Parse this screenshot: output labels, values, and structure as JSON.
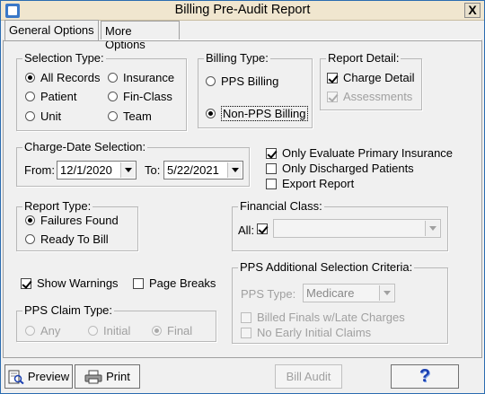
{
  "window": {
    "title": "Billing Pre-Audit Report",
    "close_glyph": "X"
  },
  "tabs": [
    "General Options",
    "More Options"
  ],
  "selection_type": {
    "label": "Selection Type:",
    "options": [
      "All Records",
      "Insurance",
      "Patient",
      "Fin-Class",
      "Unit",
      "Team"
    ],
    "selected": "All Records"
  },
  "billing_type": {
    "label": "Billing Type:",
    "options": [
      "PPS Billing",
      "Non-PPS Billing"
    ],
    "selected": "Non-PPS Billing"
  },
  "report_detail": {
    "label": "Report Detail:",
    "charge_detail": "Charge Detail",
    "assessments": "Assessments"
  },
  "charge_date": {
    "label": "Charge-Date Selection:",
    "from_label": "From:",
    "from_value": "12/1/2020",
    "to_label": "To:",
    "to_value": "5/22/2021"
  },
  "options": {
    "only_primary": "Only Evaluate Primary Insurance",
    "only_discharged": "Only Discharged Patients",
    "export": "Export Report"
  },
  "report_type": {
    "label": "Report Type:",
    "options": [
      "Failures Found",
      "Ready To Bill"
    ],
    "selected": "Failures Found"
  },
  "financial_class": {
    "label": "Financial Class:",
    "all_label": "All:",
    "value": ""
  },
  "show_warnings": "Show Warnings",
  "page_breaks": "Page Breaks",
  "pps_claim_type": {
    "label": "PPS Claim Type:",
    "options": [
      "Any",
      "Initial",
      "Final"
    ],
    "selected": "Final"
  },
  "pps_additional": {
    "label": "PPS Additional Selection Criteria:",
    "type_label": "PPS Type:",
    "type_value": "Medicare",
    "billed_finals": "Billed Finals w/Late Charges",
    "no_early": "No Early Initial Claims"
  },
  "buttons": {
    "preview": "Preview",
    "print": "Print",
    "bill_audit": "Bill Audit",
    "help": "?"
  },
  "colors": {
    "title_bar": "#f0e6cf",
    "help_icon": "#1a3fb0"
  }
}
